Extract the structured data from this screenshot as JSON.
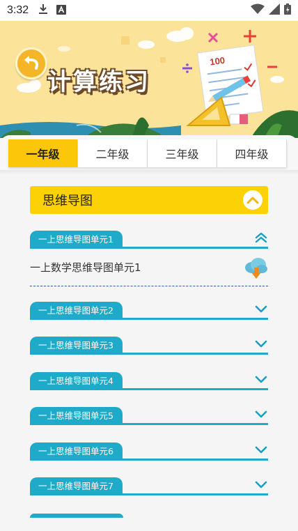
{
  "statusbar": {
    "time": "3:32"
  },
  "banner": {
    "title": "计算练习"
  },
  "tabs": [
    {
      "label": "一年级",
      "active": true
    },
    {
      "label": "二年级",
      "active": false
    },
    {
      "label": "三年级",
      "active": false
    },
    {
      "label": "四年级",
      "active": false
    }
  ],
  "section": {
    "title": "思维导图",
    "expanded": true
  },
  "units": [
    {
      "label": "一上思维导图单元1",
      "expanded": true
    },
    {
      "label": "一上思维导图单元2",
      "expanded": false
    },
    {
      "label": "一上思维导图单元3",
      "expanded": false
    },
    {
      "label": "一上思维导图单元4",
      "expanded": false
    },
    {
      "label": "一上思维导图单元5",
      "expanded": false
    },
    {
      "label": "一上思维导图单元6",
      "expanded": false
    },
    {
      "label": "一上思维导图单元7",
      "expanded": false
    }
  ],
  "files": [
    {
      "name": "一上数学思维导图单元1",
      "icon": "cloud-download-icon"
    }
  ],
  "colors": {
    "accent_yellow": "#fcd106",
    "accent_teal": "#1eaac8",
    "banner_bg": "#fbe39a"
  }
}
